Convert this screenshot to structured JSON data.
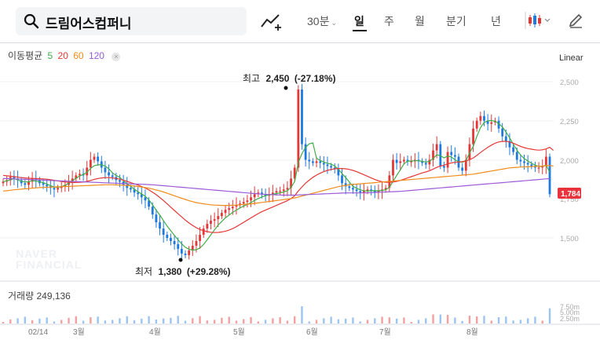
{
  "toolbar": {
    "search_value": "드림어스컴퍼니",
    "interval": "30분",
    "tabs": [
      {
        "label": "일",
        "active": true
      },
      {
        "label": "주",
        "active": false
      },
      {
        "label": "월",
        "active": false
      },
      {
        "label": "분기",
        "active": false
      },
      {
        "label": "년",
        "active": false
      }
    ],
    "icons": [
      "search-icon",
      "drawing-tool-icon",
      "candlestick-icon",
      "pencil-icon"
    ]
  },
  "ma_legend": {
    "title": "이동평균",
    "periods": [
      {
        "value": "5",
        "color": "#3fae49"
      },
      {
        "value": "20",
        "color": "#e63737"
      },
      {
        "value": "60",
        "color": "#f08c1a"
      },
      {
        "value": "120",
        "color": "#9a5bd6"
      }
    ],
    "close_label": "×"
  },
  "scale": "Linear",
  "y_axis_ticks": [
    "2,500",
    "2,250",
    "2,000",
    "1,750",
    "1,500"
  ],
  "current_price": "1,784",
  "annotations": {
    "high": {
      "prefix": "최고",
      "value": "2,450",
      "change": "(-27.18%)"
    },
    "low": {
      "prefix": "최저",
      "value": "1,380",
      "change": "(+29.28%)"
    }
  },
  "watermark": [
    "NAVER",
    "FINANCIAL"
  ],
  "volume": {
    "title": "거래량",
    "value": "249,136",
    "ticks": [
      "7.50m",
      "5.00m",
      "2.50m"
    ]
  },
  "x_axis_labels": [
    "02/14",
    "3월",
    "4월",
    "5월",
    "6월",
    "7월",
    "8월"
  ],
  "colors": {
    "up": "#e63737",
    "down": "#1f7ae0",
    "current_price_bg": "#e8323c"
  },
  "chart_data": {
    "type": "candlestick",
    "y_range": [
      1320,
      2640
    ],
    "x_labels": [
      "02/14",
      "3월",
      "4월",
      "5월",
      "6월",
      "7월",
      "8월"
    ],
    "close_series": [
      1860,
      1870,
      1890,
      1880,
      1870,
      1850,
      1840,
      1860,
      1880,
      1870,
      1850,
      1840,
      1830,
      1820,
      1810,
      1820,
      1830,
      1840,
      1860,
      1880,
      1900,
      1910,
      1900,
      1950,
      2000,
      2020,
      1990,
      1950,
      1920,
      1900,
      1890,
      1870,
      1860,
      1840,
      1820,
      1810,
      1790,
      1780,
      1760,
      1740,
      1700,
      1650,
      1600,
      1560,
      1520,
      1500,
      1480,
      1460,
      1430,
      1400,
      1390,
      1420,
      1450,
      1480,
      1520,
      1560,
      1590,
      1610,
      1620,
      1640,
      1660,
      1680,
      1690,
      1700,
      1710,
      1720,
      1730,
      1740,
      1760,
      1780,
      1790,
      1780,
      1770,
      1780,
      1790,
      1800,
      1800,
      1810,
      1820,
      1880,
      1950,
      2450,
      2100,
      2000,
      1990,
      1980,
      1990,
      1980,
      1970,
      1960,
      1950,
      1940,
      1900,
      1850,
      1830,
      1820,
      1810,
      1800,
      1790,
      1800,
      1810,
      1800,
      1790,
      1800,
      1810,
      1820,
      1900,
      2000,
      1980,
      1990,
      2000,
      1990,
      1990,
      2000,
      1990,
      1980,
      1970,
      2000,
      2060,
      2100,
      1960,
      1950,
      2050,
      2030,
      2020,
      1950,
      1930,
      2000,
      2100,
      2200,
      2250,
      2280,
      2250,
      2230,
      2240,
      2250,
      2200,
      2150,
      2120,
      2080,
      2050,
      2000,
      1990,
      1980,
      1970,
      1960,
      1950,
      1950,
      1960,
      2020,
      1780
    ],
    "series": [
      {
        "name": "5",
        "values": [
          1860,
          1865,
          1872,
          1880,
          1872,
          1862,
          1858,
          1860,
          1866,
          1864,
          1860,
          1854,
          1845,
          1834,
          1826,
          1824,
          1828,
          1836,
          1850,
          1866,
          1882,
          1896,
          1906,
          1920,
          1945,
          1962,
          1968,
          1968,
          1960,
          1942,
          1916,
          1900,
          1888,
          1866,
          1846,
          1830,
          1812,
          1796,
          1782,
          1766,
          1744,
          1712,
          1678,
          1646,
          1610,
          1576,
          1546,
          1516,
          1488,
          1462,
          1440,
          1428,
          1422,
          1424,
          1436,
          1458,
          1488,
          1520,
          1552,
          1582,
          1606,
          1628,
          1646,
          1664,
          1678,
          1692,
          1704,
          1714,
          1726,
          1740,
          1752,
          1762,
          1770,
          1776,
          1780,
          1784,
          1788,
          1794,
          1802,
          1824,
          1860,
          1982,
          2040,
          2080,
          2102,
          2108,
          2010,
          1996,
          1986,
          1978,
          1972,
          1960,
          1940,
          1912,
          1886,
          1858,
          1830,
          1818,
          1808,
          1802,
          1800,
          1802,
          1802,
          1802,
          1804,
          1808,
          1824,
          1862,
          1900,
          1936,
          1974,
          1992,
          1992,
          1994,
          1994,
          1990,
          1986,
          1990,
          2008,
          2032,
          2026,
          2012,
          2024,
          2018,
          2000,
          1988,
          1984,
          1994,
          2044,
          2086,
          2150,
          2206,
          2238,
          2250,
          2252,
          2246,
          2232,
          2210,
          2178,
          2140,
          2100,
          2062,
          2030,
          2008,
          1992,
          1978,
          1966,
          1958,
          1958,
          1966,
          1920
        ]
      },
      {
        "name": "20",
        "values": [
          1900,
          1898,
          1895,
          1892,
          1889,
          1886,
          1884,
          1882,
          1881,
          1880,
          1879,
          1878,
          1876,
          1873,
          1869,
          1865,
          1861,
          1858,
          1856,
          1855,
          1855,
          1856,
          1858,
          1862,
          1868,
          1875,
          1880,
          1884,
          1886,
          1886,
          1884,
          1881,
          1876,
          1870,
          1862,
          1854,
          1846,
          1838,
          1829,
          1819,
          1807,
          1793,
          1777,
          1759,
          1739,
          1718,
          1697,
          1676,
          1655,
          1634,
          1614,
          1596,
          1580,
          1566,
          1554,
          1546,
          1540,
          1536,
          1534,
          1535,
          1538,
          1543,
          1550,
          1560,
          1572,
          1586,
          1600,
          1614,
          1628,
          1642,
          1656,
          1668,
          1678,
          1688,
          1698,
          1708,
          1718,
          1728,
          1738,
          1752,
          1770,
          1800,
          1826,
          1850,
          1870,
          1888,
          1902,
          1914,
          1924,
          1932,
          1938,
          1942,
          1944,
          1944,
          1942,
          1938,
          1932,
          1924,
          1914,
          1904,
          1894,
          1884,
          1874,
          1866,
          1860,
          1856,
          1856,
          1858,
          1862,
          1868,
          1876,
          1884,
          1892,
          1900,
          1908,
          1916,
          1922,
          1930,
          1940,
          1952,
          1960,
          1966,
          1974,
          1980,
          1984,
          1986,
          1988,
          1992,
          2000,
          2012,
          2028,
          2046,
          2064,
          2080,
          2094,
          2106,
          2114,
          2118,
          2118,
          2114,
          2106,
          2096,
          2086,
          2078,
          2072,
          2068,
          2064,
          2062,
          2064,
          2070,
          2080,
          2060
        ]
      },
      {
        "name": "60",
        "values": [
          1800,
          1802,
          1805,
          1808,
          1810,
          1812,
          1814,
          1816,
          1818,
          1820,
          1822,
          1823,
          1824,
          1825,
          1826,
          1827,
          1828,
          1829,
          1830,
          1831,
          1832,
          1833,
          1834,
          1835,
          1836,
          1837,
          1838,
          1839,
          1840,
          1840,
          1840,
          1839,
          1838,
          1837,
          1836,
          1834,
          1832,
          1829,
          1826,
          1822,
          1818,
          1813,
          1807,
          1801,
          1794,
          1786,
          1778,
          1770,
          1762,
          1754,
          1746,
          1738,
          1732,
          1726,
          1722,
          1718,
          1715,
          1712,
          1710,
          1709,
          1708,
          1708,
          1708,
          1709,
          1710,
          1712,
          1714,
          1716,
          1718,
          1721,
          1724,
          1727,
          1730,
          1733,
          1736,
          1739,
          1742,
          1745,
          1748,
          1752,
          1756,
          1762,
          1768,
          1774,
          1780,
          1786,
          1792,
          1798,
          1804,
          1810,
          1816,
          1822,
          1828,
          1832,
          1836,
          1840,
          1842,
          1844,
          1846,
          1848,
          1850,
          1852,
          1854,
          1856,
          1858,
          1860,
          1862,
          1864,
          1866,
          1868,
          1870,
          1872,
          1874,
          1876,
          1878,
          1880,
          1882,
          1884,
          1886,
          1888,
          1890,
          1892,
          1894,
          1896,
          1898,
          1900,
          1902,
          1904,
          1906,
          1908,
          1912,
          1916,
          1920,
          1924,
          1928,
          1932,
          1936,
          1940,
          1944,
          1948,
          1950,
          1952,
          1954,
          1955,
          1956,
          1957,
          1958,
          1959,
          1960,
          1962,
          1964,
          1960
        ]
      },
      {
        "name": "120",
        "values": [
          1880,
          1880,
          1879,
          1878,
          1877,
          1876,
          1875,
          1874,
          1873,
          1872,
          1871,
          1870,
          1869,
          1868,
          1867,
          1866,
          1865,
          1864,
          1863,
          1862,
          1861,
          1860,
          1859,
          1858,
          1857,
          1856,
          1855,
          1854,
          1853,
          1852,
          1851,
          1850,
          1849,
          1848,
          1847,
          1846,
          1845,
          1844,
          1843,
          1842,
          1841,
          1840,
          1838,
          1836,
          1834,
          1832,
          1830,
          1828,
          1826,
          1824,
          1822,
          1820,
          1818,
          1816,
          1814,
          1812,
          1810,
          1808,
          1806,
          1804,
          1802,
          1800,
          1798,
          1796,
          1794,
          1792,
          1790,
          1788,
          1786,
          1784,
          1782,
          1780,
          1779,
          1778,
          1777,
          1776,
          1775,
          1774,
          1774,
          1774,
          1774,
          1775,
          1776,
          1777,
          1778,
          1779,
          1780,
          1781,
          1782,
          1783,
          1784,
          1785,
          1786,
          1787,
          1788,
          1788,
          1788,
          1788,
          1788,
          1788,
          1789,
          1790,
          1791,
          1792,
          1793,
          1794,
          1795,
          1796,
          1797,
          1798,
          1800,
          1802,
          1804,
          1806,
          1808,
          1810,
          1812,
          1814,
          1816,
          1818,
          1820,
          1822,
          1824,
          1826,
          1828,
          1830,
          1832,
          1834,
          1836,
          1838,
          1840,
          1842,
          1844,
          1846,
          1848,
          1850,
          1852,
          1854,
          1856,
          1858,
          1860,
          1862,
          1864,
          1866,
          1868,
          1870,
          1872,
          1874,
          1876,
          1878,
          1880
        ]
      }
    ]
  }
}
